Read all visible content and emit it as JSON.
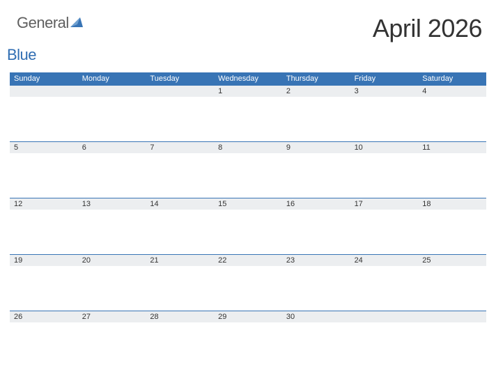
{
  "logo": {
    "text_general": "General",
    "text_blue": "Blue"
  },
  "title": "April 2026",
  "weekdays": [
    "Sunday",
    "Monday",
    "Tuesday",
    "Wednesday",
    "Thursday",
    "Friday",
    "Saturday"
  ],
  "weeks": [
    [
      "",
      "",
      "",
      "1",
      "2",
      "3",
      "4"
    ],
    [
      "5",
      "6",
      "7",
      "8",
      "9",
      "10",
      "11"
    ],
    [
      "12",
      "13",
      "14",
      "15",
      "16",
      "17",
      "18"
    ],
    [
      "19",
      "20",
      "21",
      "22",
      "23",
      "24",
      "25"
    ],
    [
      "26",
      "27",
      "28",
      "29",
      "30",
      "",
      ""
    ]
  ],
  "colors": {
    "brand_blue": "#3874b5",
    "gray_band": "#eceef0"
  }
}
